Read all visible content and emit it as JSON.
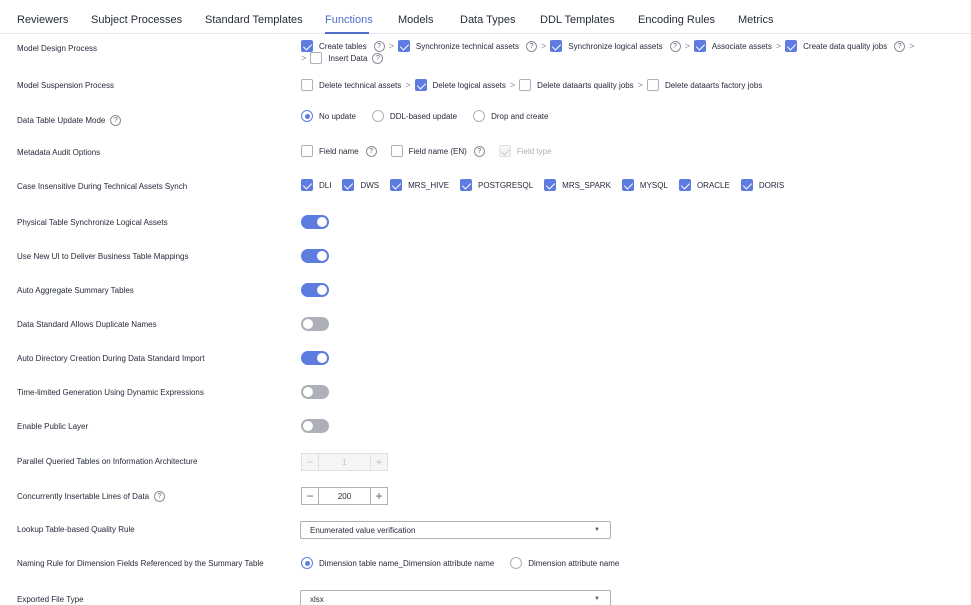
{
  "tabs": [
    {
      "label": "Reviewers"
    },
    {
      "label": "Subject Processes"
    },
    {
      "label": "Standard Templates"
    },
    {
      "label": "Functions",
      "active": true
    },
    {
      "label": "Models"
    },
    {
      "label": "Data Types"
    },
    {
      "label": "DDL Templates"
    },
    {
      "label": "Encoding Rules"
    },
    {
      "label": "Metrics"
    }
  ],
  "design": {
    "label": "Model Design Process",
    "steps": [
      "Create tables",
      "Synchronize technical assets",
      "Synchronize logical assets",
      "Associate assets",
      "Create data quality jobs",
      "Insert Data"
    ]
  },
  "suspension": {
    "label": "Model Suspension Process",
    "steps": [
      "Delete technical assets",
      "Delete logical assets",
      "Delete dataarts quality jobs",
      "Delete dataarts factory jobs"
    ]
  },
  "update_mode": {
    "label": "Data Table Update Mode",
    "options": [
      "No update",
      "DDL-based update",
      "Drop and create"
    ],
    "selected": "No update"
  },
  "audit": {
    "label": "Metadata Audit Options",
    "options": [
      "Field name",
      "Field name (EN)",
      "Field type"
    ]
  },
  "case_insensitive": {
    "label": "Case Insensitive During Technical Assets Synch",
    "options": [
      "DLI",
      "DWS",
      "MRS_HIVE",
      "POSTGRESQL",
      "MRS_SPARK",
      "MYSQL",
      "ORACLE",
      "DORIS"
    ]
  },
  "toggles": [
    {
      "label": "Physical Table Synchronize Logical Assets",
      "on": true
    },
    {
      "label": "Use New UI to Deliver Business Table Mappings",
      "on": true
    },
    {
      "label": "Auto Aggregate Summary Tables",
      "on": true
    },
    {
      "label": "Data Standard Allows Duplicate Names",
      "on": false
    },
    {
      "label": "Auto Directory Creation During Data Standard Import",
      "on": true
    },
    {
      "label": "Time-limited Generation Using Dynamic Expressions",
      "on": false
    },
    {
      "label": "Enable Public Layer",
      "on": false
    }
  ],
  "parallel": {
    "label": "Parallel Queried Tables on Information Architecture",
    "value": "1",
    "minus": "−",
    "plus": "+"
  },
  "concurrent": {
    "label": "Concurrently Insertable Lines of Data",
    "value": "200",
    "minus": "−",
    "plus": "+"
  },
  "lookup": {
    "label": "Lookup Table-based Quality Rule",
    "value": "Enumerated value verification"
  },
  "naming": {
    "label": "Naming Rule for Dimension Fields Referenced by the Summary Table",
    "options": [
      "Dimension table name_Dimension attribute name",
      "Dimension attribute name"
    ],
    "selected": "Dimension table name_Dimension attribute name"
  },
  "export": {
    "label": "Exported File Type",
    "value": "xlsx"
  },
  "icons": {
    "help": "?",
    "separator": ">",
    "caret": "▼"
  },
  "colors": {
    "accent": "#5e7ce0",
    "tab_active": "#526ecc",
    "toggle_off": "#adb0b8"
  }
}
